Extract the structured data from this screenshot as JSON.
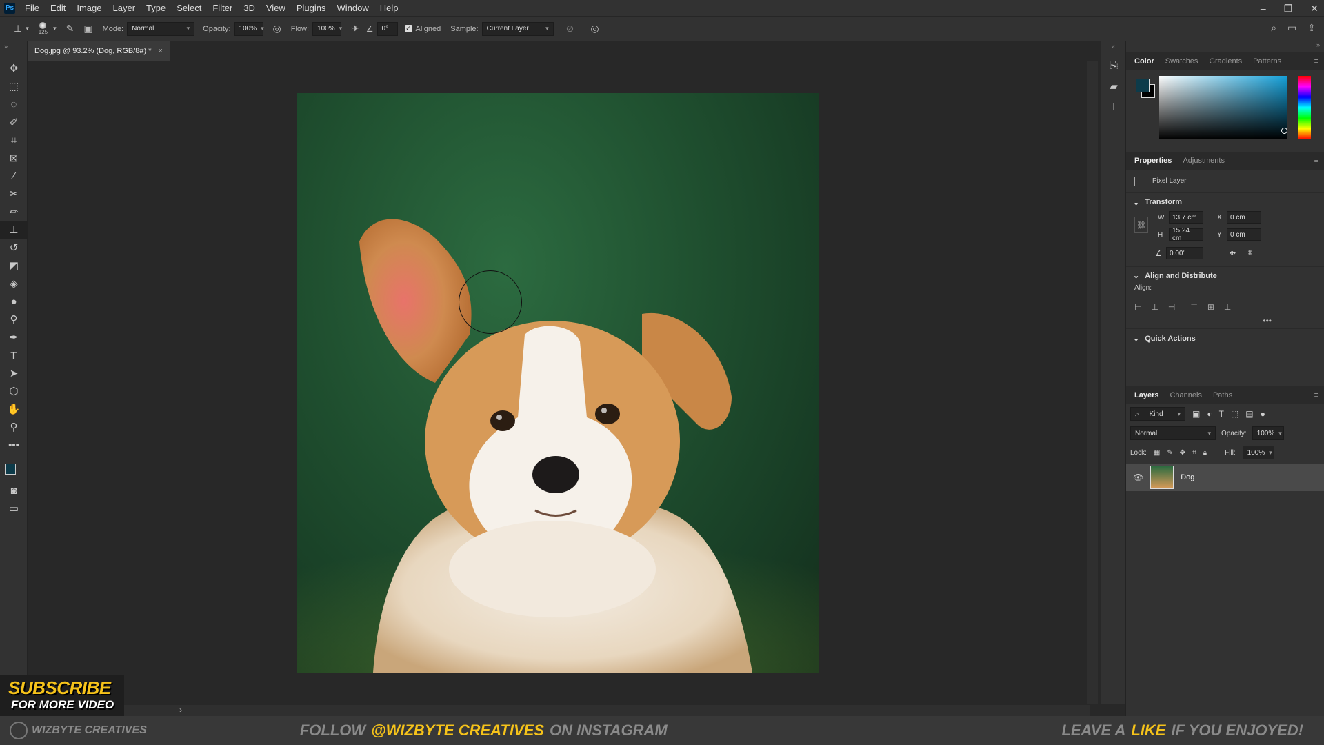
{
  "menubar": {
    "logo": "Ps",
    "items": [
      "File",
      "Edit",
      "Image",
      "Layer",
      "Type",
      "Select",
      "Filter",
      "3D",
      "View",
      "Plugins",
      "Window",
      "Help"
    ]
  },
  "options": {
    "brush_size": "125",
    "mode_label": "Mode:",
    "mode_value": "Normal",
    "opacity_label": "Opacity:",
    "opacity_value": "100%",
    "flow_label": "Flow:",
    "flow_value": "100%",
    "angle_value": "0°",
    "aligned_label": "Aligned",
    "sample_label": "Sample:",
    "sample_value": "Current Layer"
  },
  "document_tab": {
    "title": "Dog.jpg @ 93.2% (Dog, RGB/8#) *"
  },
  "color_panel": {
    "tabs": [
      "Color",
      "Swatches",
      "Gradients",
      "Patterns"
    ],
    "foreground": "#0d3b4a",
    "background": "#000000"
  },
  "properties_panel": {
    "tabs": [
      "Properties",
      "Adjustments"
    ],
    "layer_type": "Pixel Layer",
    "transform_title": "Transform",
    "w_label": "W",
    "w_value": "13.7 cm",
    "h_label": "H",
    "h_value": "15.24 cm",
    "x_label": "X",
    "x_value": "0 cm",
    "y_label": "Y",
    "y_value": "0 cm",
    "angle_value": "0.00°",
    "align_title": "Align and Distribute",
    "align_label": "Align:",
    "quick_actions": "Quick Actions"
  },
  "layers_panel": {
    "tabs": [
      "Layers",
      "Channels",
      "Paths"
    ],
    "kind_label": "Kind",
    "blend_mode": "Normal",
    "opacity_label": "Opacity:",
    "opacity_value": "100%",
    "lock_label": "Lock:",
    "fill_label": "Fill:",
    "fill_value": "100%",
    "layer_name": "Dog"
  },
  "overlay": {
    "subscribe_line1": "SUBSCRIBE",
    "subscribe_line2": "FOR MORE VIDEO",
    "brand": "WIZBYTE CREATIVES",
    "follow_prefix": "FOLLOW",
    "follow_handle": "@WIZBYTE CREATIVES",
    "follow_suffix": "ON INSTAGRAM",
    "leave_prefix": "LEAVE A",
    "leave_like": "LIKE",
    "leave_suffix": "IF YOU ENJOYED!",
    "accent_color": "#f6c31a"
  }
}
